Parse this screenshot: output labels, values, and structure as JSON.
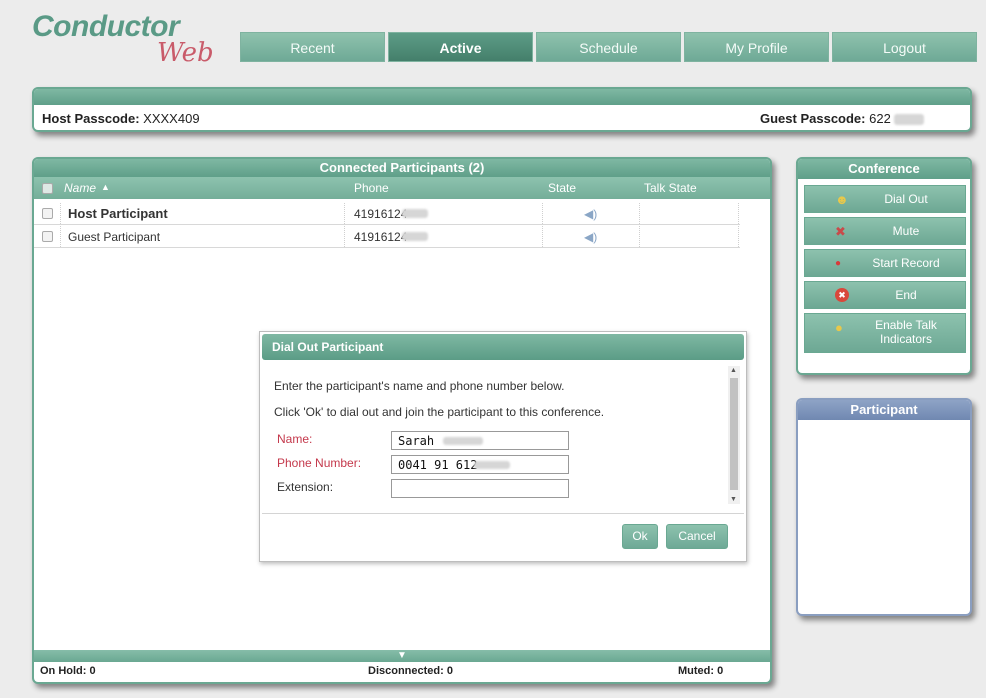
{
  "brand": {
    "name": "Conductor",
    "sub": "Web"
  },
  "nav": {
    "tabs": [
      "Recent",
      "Active",
      "Schedule",
      "My Profile",
      "Logout"
    ],
    "active_index": 1
  },
  "passcodes": {
    "host_label": "Host Passcode:",
    "host_value": "XXXX409",
    "guest_label": "Guest Passcode:",
    "guest_value": "622"
  },
  "participants": {
    "title": "Connected Participants (2)",
    "columns": [
      "Name",
      "Phone",
      "State",
      "Talk State"
    ],
    "rows": [
      {
        "name": "Host Participant",
        "phone": "41916124"
      },
      {
        "name": "Guest Participant",
        "phone": "41916124"
      }
    ],
    "footer": {
      "on_hold": "On Hold: 0",
      "disconnected": "Disconnected: 0",
      "muted": "Muted: 0"
    }
  },
  "conference": {
    "title": "Conference",
    "buttons": [
      {
        "label": "Dial Out",
        "icon": "user-add-icon"
      },
      {
        "label": "Mute",
        "icon": "mute-icon"
      },
      {
        "label": "Start Record",
        "icon": "record-icon"
      },
      {
        "label": "End",
        "icon": "end-icon"
      },
      {
        "label": "Enable Talk Indicators",
        "icon": "speech-bubble-icon"
      }
    ]
  },
  "participant_panel": {
    "title": "Participant"
  },
  "dialog": {
    "title": "Dial Out Participant",
    "line1": "Enter the participant's name and phone number below.",
    "line2": "Click 'Ok' to dial out and join the participant to this conference.",
    "name_label": "Name:",
    "name_value": "Sarah",
    "phone_label": "Phone Number:",
    "phone_value": "0041 91 612",
    "ext_label": "Extension:",
    "ext_value": "",
    "ok_label": "Ok",
    "cancel_label": "Cancel"
  },
  "colors": {
    "accent": "#6aa892",
    "accent_dark": "#447f6b",
    "required": "#c4384b",
    "side_panel": "#8a9ec0"
  }
}
